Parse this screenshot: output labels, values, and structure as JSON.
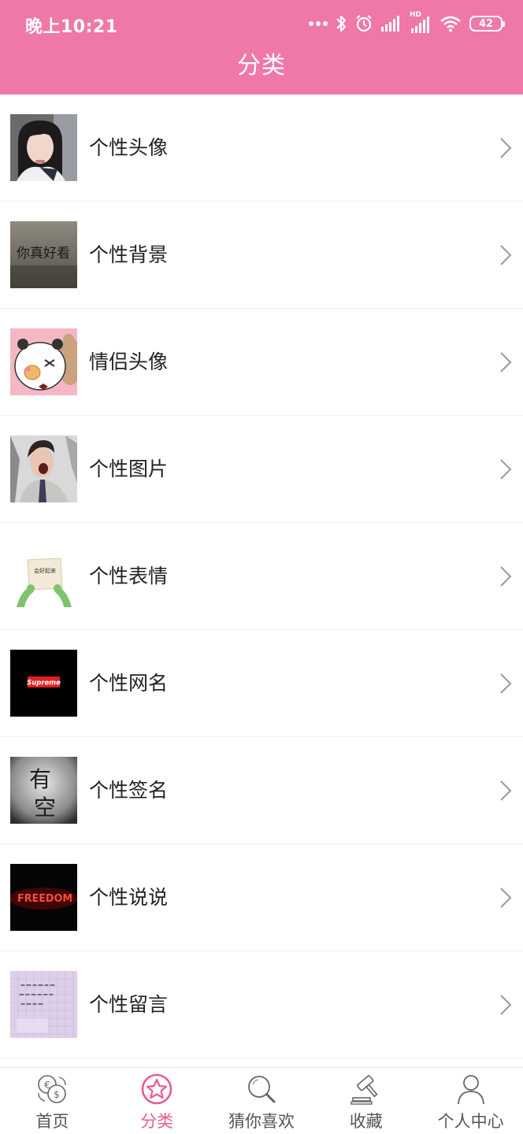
{
  "status_bar": {
    "time": "晚上10:21",
    "hd_label": "HD",
    "battery": "42"
  },
  "header": {
    "title": "分类",
    "bg_color": "#ef78a8"
  },
  "categories": [
    {
      "label": "个性头像",
      "icon": "portrait-girl-thumbnail"
    },
    {
      "label": "个性背景",
      "icon": "calligraphy-wall-thumbnail"
    },
    {
      "label": "情侣头像",
      "icon": "cartoon-bear-thumbnail"
    },
    {
      "label": "个性图片",
      "icon": "man-shouting-thumbnail"
    },
    {
      "label": "个性表情",
      "icon": "frog-holding-sign-thumbnail"
    },
    {
      "label": "个性网名",
      "icon": "supreme-logo-thumbnail"
    },
    {
      "label": "个性签名",
      "icon": "you-kong-calligraphy-thumbnail"
    },
    {
      "label": "个性说说",
      "icon": "neon-freedom-thumbnail"
    },
    {
      "label": "个性留言",
      "icon": "handwritten-note-thumbnail"
    }
  ],
  "thumb_text": {
    "calligraphy": "你真好看",
    "supreme": "Supreme",
    "sign_text": "会好起来",
    "youkong_1": "有",
    "youkong_2": "空",
    "neon": "FREEDOM"
  },
  "tabbar": {
    "active_color": "#e55c93",
    "tabs": [
      {
        "label": "首页",
        "icon": "currency-exchange-icon",
        "active": false
      },
      {
        "label": "分类",
        "icon": "star-circle-icon",
        "active": true
      },
      {
        "label": "猜你喜欢",
        "icon": "search-icon",
        "active": false
      },
      {
        "label": "收藏",
        "icon": "gavel-icon",
        "active": false
      },
      {
        "label": "个人中心",
        "icon": "user-icon",
        "active": false
      }
    ]
  }
}
